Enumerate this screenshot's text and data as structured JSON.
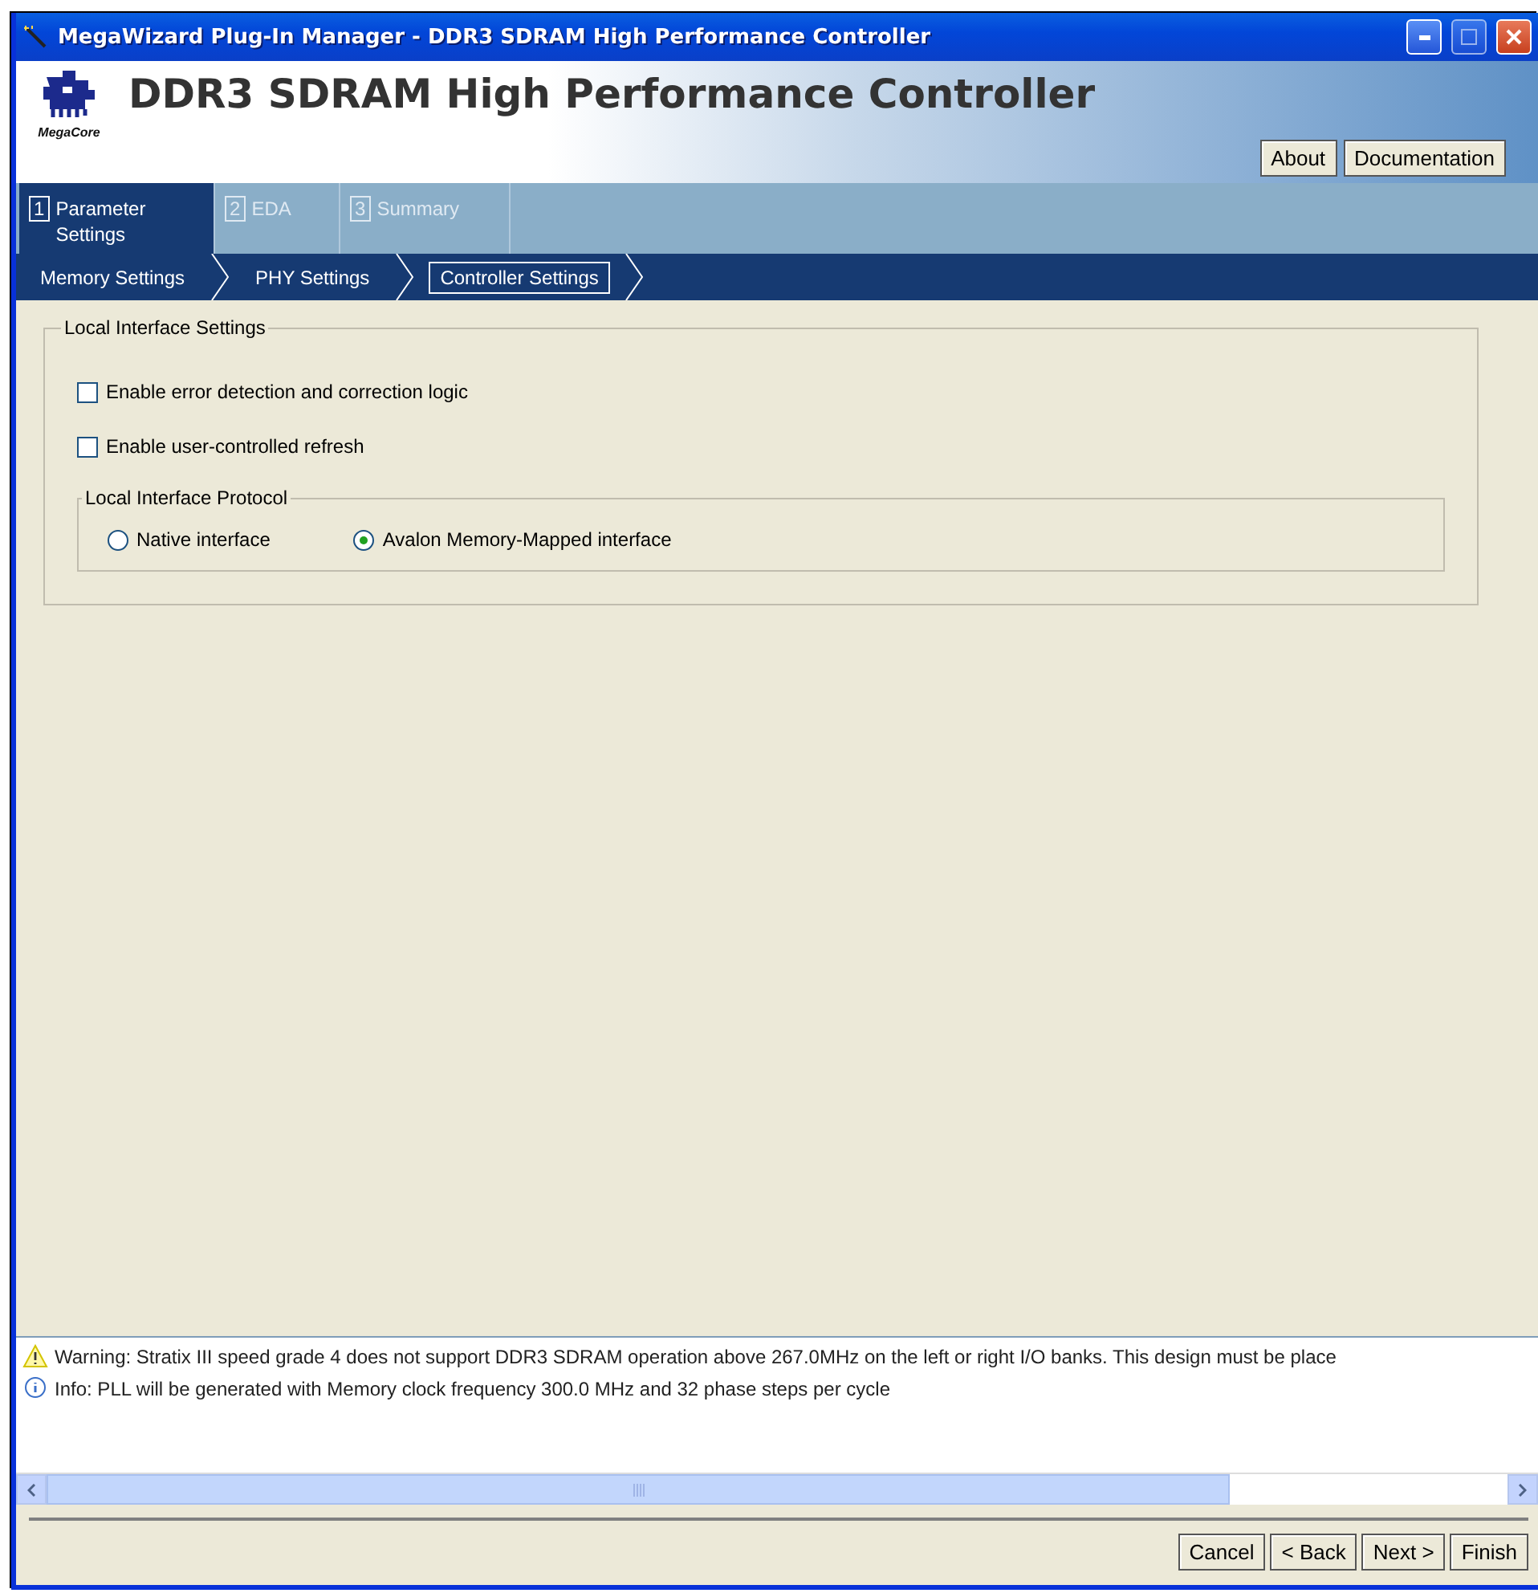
{
  "window": {
    "title": "MegaWizard Plug-In Manager - DDR3 SDRAM High Performance Controller"
  },
  "header": {
    "logo_caption": "MegaCore",
    "title": "DDR3 SDRAM High Performance Controller",
    "buttons": [
      "About",
      "Documentation"
    ]
  },
  "tabs": [
    {
      "number": "1",
      "label": "Parameter Settings",
      "selected": true
    },
    {
      "number": "2",
      "label": "EDA",
      "selected": false
    },
    {
      "number": "3",
      "label": "Summary",
      "selected": false
    }
  ],
  "steps": [
    {
      "label": "Memory Settings",
      "selected": false
    },
    {
      "label": "PHY Settings",
      "selected": false
    },
    {
      "label": "Controller Settings",
      "selected": true
    }
  ],
  "group": {
    "title": "Local Interface Settings",
    "options": [
      {
        "label": "Enable error detection and correction logic",
        "checked": false
      },
      {
        "label": "Enable user-controlled refresh",
        "checked": false
      }
    ],
    "protocol": {
      "title": "Local Interface Protocol",
      "choices": [
        {
          "label": "Native interface",
          "selected": false
        },
        {
          "label": "Avalon Memory-Mapped interface",
          "selected": true
        }
      ]
    }
  },
  "messages": [
    {
      "kind": "warning",
      "text": "Warning: Stratix III speed grade 4 does not support DDR3 SDRAM operation above 267.0MHz on the left or right I/O banks.  This design must be place"
    },
    {
      "kind": "info",
      "text": "Info: PLL will be generated with Memory clock frequency 300.0 MHz and 32 phase steps per cycle"
    }
  ],
  "footer_buttons": [
    "Cancel",
    "< Back",
    "Next >",
    "Finish"
  ]
}
